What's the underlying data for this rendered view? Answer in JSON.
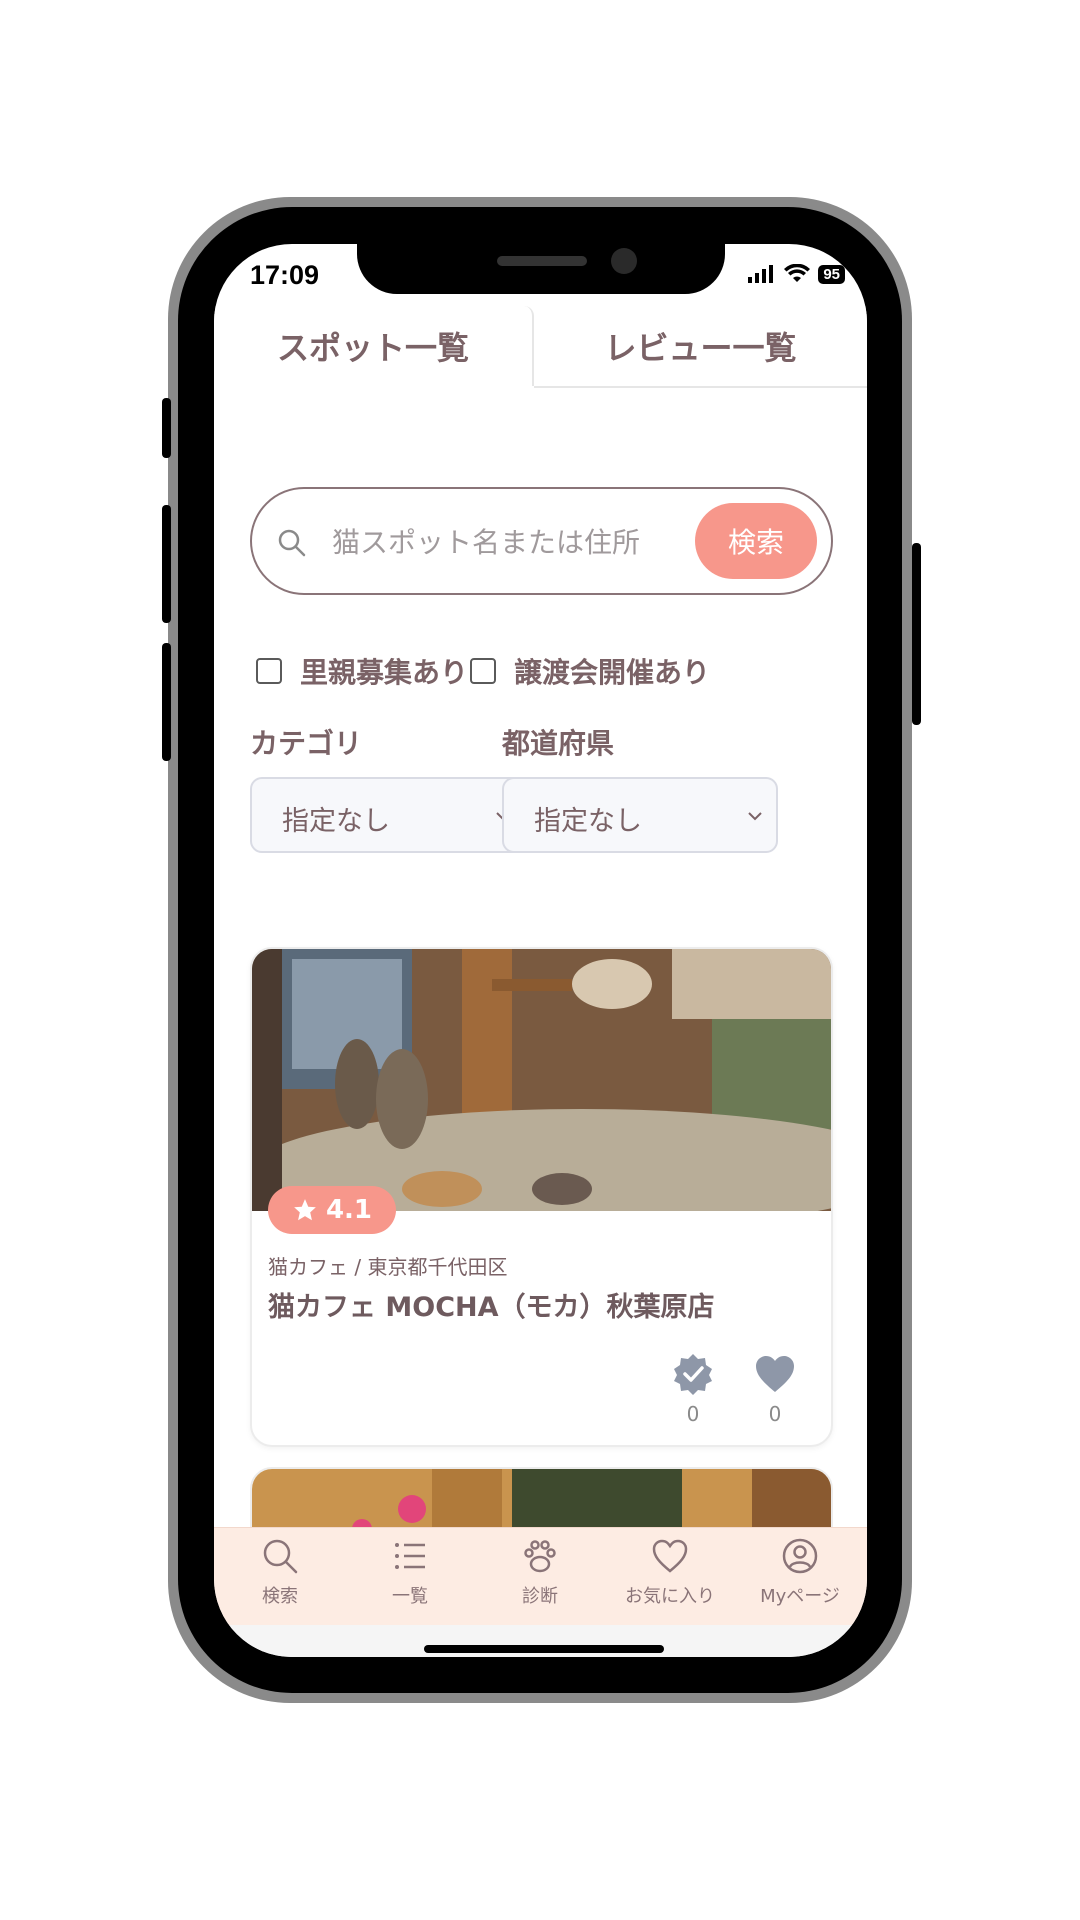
{
  "status_bar": {
    "time": "17:09",
    "battery": "95"
  },
  "tabs": [
    {
      "label": "スポット一覧",
      "active": true
    },
    {
      "label": "レビュー一覧",
      "active": false
    }
  ],
  "search": {
    "placeholder": "猫スポット名または住所",
    "button_label": "検索"
  },
  "checkboxes": [
    {
      "label": "里親募集あり",
      "checked": false
    },
    {
      "label": "譲渡会開催あり",
      "checked": false
    }
  ],
  "filters": {
    "category": {
      "label": "カテゴリ",
      "value": "指定なし"
    },
    "prefecture": {
      "label": "都道府県",
      "value": "指定なし"
    }
  },
  "spots": [
    {
      "rating": "4.1",
      "meta": "猫カフェ / 東京都千代田区",
      "title": "猫カフェ MOCHA（モカ）秋葉原店",
      "visited_count": "0",
      "favorite_count": "0"
    }
  ],
  "bottom_nav": [
    {
      "label": "検索",
      "icon": "search-icon"
    },
    {
      "label": "一覧",
      "icon": "list-icon"
    },
    {
      "label": "診断",
      "icon": "paw-icon"
    },
    {
      "label": "お気に入り",
      "icon": "heart-icon"
    },
    {
      "label": "Myページ",
      "icon": "user-circle-icon"
    }
  ],
  "colors": {
    "accent": "#f7978b",
    "text": "#7a6266",
    "nav_bg": "#fdece3"
  }
}
